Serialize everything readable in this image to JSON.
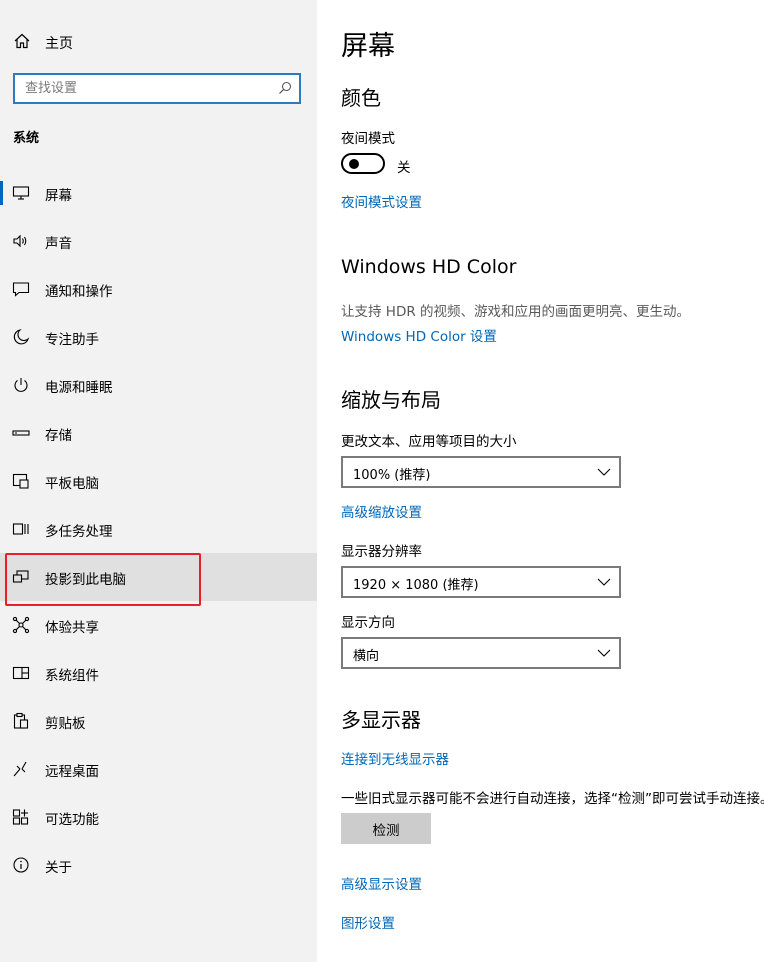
{
  "sidebar": {
    "home_label": "主页",
    "search_placeholder": "查找设置",
    "section_title": "系统",
    "items": [
      {
        "label": "屏幕",
        "icon": "monitor-icon"
      },
      {
        "label": "声音",
        "icon": "speaker-icon"
      },
      {
        "label": "通知和操作",
        "icon": "notification-icon"
      },
      {
        "label": "专注助手",
        "icon": "moon-icon"
      },
      {
        "label": "电源和睡眠",
        "icon": "power-icon"
      },
      {
        "label": "存储",
        "icon": "storage-icon"
      },
      {
        "label": "平板电脑",
        "icon": "tablet-icon"
      },
      {
        "label": "多任务处理",
        "icon": "multitasking-icon"
      },
      {
        "label": "投影到此电脑",
        "icon": "projection-icon"
      },
      {
        "label": "体验共享",
        "icon": "share-icon"
      },
      {
        "label": "系统组件",
        "icon": "components-icon"
      },
      {
        "label": "剪贴板",
        "icon": "clipboard-icon"
      },
      {
        "label": "远程桌面",
        "icon": "remote-desktop-icon"
      },
      {
        "label": "可选功能",
        "icon": "optional-features-icon"
      },
      {
        "label": "关于",
        "icon": "info-icon"
      }
    ],
    "highlight_color": "#e8202a",
    "accent_color": "#0067c0"
  },
  "main": {
    "title": "屏幕",
    "color": {
      "heading": "颜色",
      "night_mode_label": "夜间模式",
      "night_mode_state": "关",
      "night_mode_link": "夜间模式设置"
    },
    "hd": {
      "heading": "Windows HD Color",
      "description": "让支持 HDR 的视频、游戏和应用的画面更明亮、更生动。",
      "link": "Windows HD Color 设置"
    },
    "scale": {
      "heading": "缩放与布局",
      "size_label": "更改文本、应用等项目的大小",
      "size_value": "100% (推荐)",
      "advanced_link": "高级缩放设置",
      "resolution_label": "显示器分辨率",
      "resolution_value": "1920 × 1080 (推荐)",
      "orientation_label": "显示方向",
      "orientation_value": "横向"
    },
    "multi": {
      "heading": "多显示器",
      "wireless_link": "连接到无线显示器",
      "description": "一些旧式显示器可能不会进行自动连接，选择“检测”即可尝试手动连接。",
      "detect_button": "检测",
      "advanced_display_link": "高级显示设置",
      "graphics_link": "图形设置"
    }
  }
}
